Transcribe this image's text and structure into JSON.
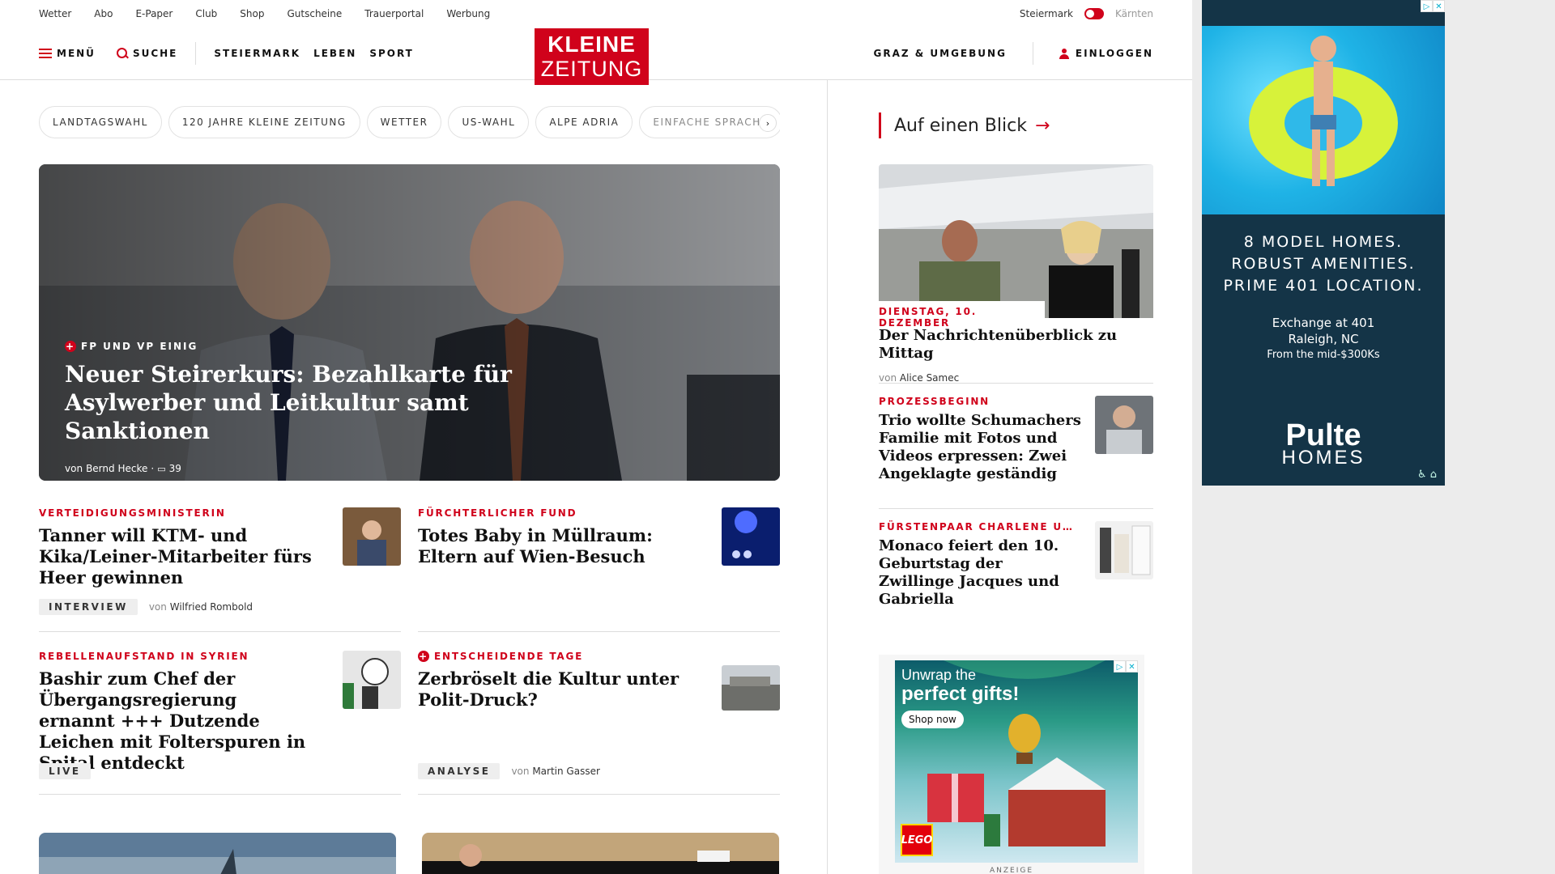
{
  "utility": {
    "links": [
      "Wetter",
      "Abo",
      "E-Paper",
      "Club",
      "Shop",
      "Gutscheine",
      "Trauerportal",
      "Werbung"
    ],
    "region_on": "Steiermark",
    "region_off": "Kärnten"
  },
  "header": {
    "menu": "MENÜ",
    "search": "SUCHE",
    "nav": [
      "STEIERMARK",
      "LEBEN",
      "SPORT"
    ],
    "logo_top": "KLEINE",
    "logo_bottom": "ZEITUNG",
    "region_link": "GRAZ & UMGEBUNG",
    "login": "EINLOGGEN"
  },
  "tags": [
    "LANDTAGSWAHL",
    "120 JAHRE KLEINE ZEITUNG",
    "WETTER",
    "US-WAHL",
    "ALPE ADRIA",
    "EINFACHE SPRACHE"
  ],
  "hero": {
    "kicker": "FP UND VP EINIG",
    "title": "Neuer Steirerkurs: Bezahlkarte für Asylwerber und Leitkultur samt Sanktionen",
    "author_prefix": "von",
    "author": "Bernd Hecke",
    "comments": "39"
  },
  "articles": [
    {
      "kicker": "VERTEIDIGUNGSMINISTERIN",
      "title": "Tanner will KTM- und Kika/Leiner-Mitarbeiter fürs Heer gewinnen",
      "badge": "INTERVIEW",
      "author_prefix": "von",
      "author": "Wilfried Rombold"
    },
    {
      "kicker": "FÜRCHTERLICHER FUND",
      "title": "Totes Baby in Müllraum: Eltern auf Wien-Besuch"
    },
    {
      "kicker": "REBELLENAUFSTAND IN SYRIEN",
      "title": "Bashir zum Chef der Übergangsregierung ernannt +++ Dutzende Leichen mit Folterspuren in Spital entdeckt",
      "badge": "LIVE"
    },
    {
      "kicker": "ENTSCHEIDENDE TAGE",
      "title": "Zerbröselt die Kultur unter Polit-Druck?",
      "badge": "ANALYSE",
      "author_prefix": "von",
      "author": "Martin Gasser"
    }
  ],
  "sidebar": {
    "heading": "Auf einen Blick",
    "lead_date": "DIENSTAG, 10. DEZEMBER",
    "lead_title": "Der Nachrichtenüberblick zu Mittag",
    "lead_author_prefix": "von",
    "lead_author": "Alice Samec",
    "items": [
      {
        "kicker": "PROZESSBEGINN",
        "title": "Trio wollte Schumachers Familie mit Fotos und Videos erpressen: Zwei Angeklagte geständig"
      },
      {
        "kicker": "FÜRSTENPAAR CHARLENE U…",
        "title": "Monaco feiert den 10. Geburtstag der Zwillinge Jacques und Gabriella"
      }
    ]
  },
  "ads": {
    "pulte_headline": [
      "8 MODEL HOMES.",
      "ROBUST AMENITIES.",
      "PRIME 401 LOCATION."
    ],
    "pulte_place": [
      "Exchange at 401",
      "Raleigh, NC"
    ],
    "pulte_price": "From the mid-$300Ks",
    "pulte_brand": "Pulte",
    "pulte_brand2": "HOMES",
    "lego_line1": "Unwrap the",
    "lego_line2": "perfect gifts!",
    "lego_button": "Shop now",
    "lego_logo": "LEGO",
    "ad_label": "ANZEIGE"
  }
}
